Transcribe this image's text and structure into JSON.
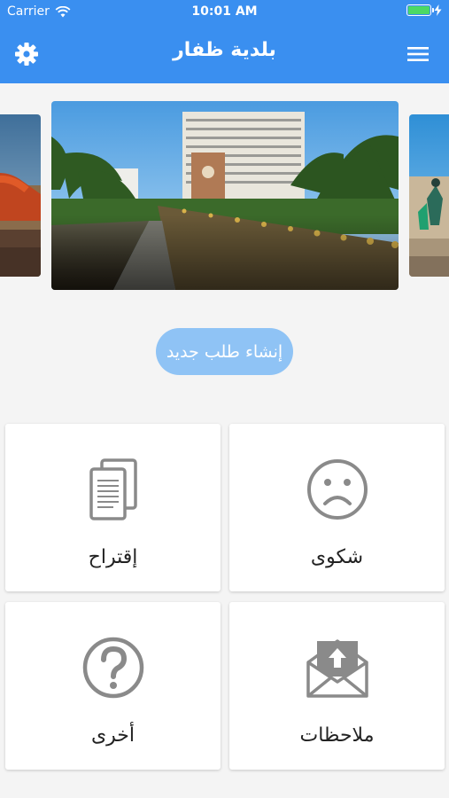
{
  "status_bar": {
    "carrier": "Carrier",
    "time": "10:01 AM"
  },
  "header": {
    "title": "بلدية ظفار",
    "left_icon": "gear-icon",
    "right_icon": "hamburger-menu-icon"
  },
  "carousel": {
    "slides": [
      "left-partial",
      "main",
      "right-partial"
    ]
  },
  "cta": {
    "label": "إنشاء طلب جديد"
  },
  "cards": [
    {
      "label": "شكوى",
      "icon": "sad-face-icon"
    },
    {
      "label": "إقتراح",
      "icon": "documents-icon"
    },
    {
      "label": "ملاحظات",
      "icon": "envelope-upload-icon"
    },
    {
      "label": "أخرى",
      "icon": "question-circle-icon"
    }
  ],
  "colors": {
    "primary": "#3a8ff0",
    "cta": "#8fc3f5",
    "icon_gray": "#8a8a8a"
  }
}
